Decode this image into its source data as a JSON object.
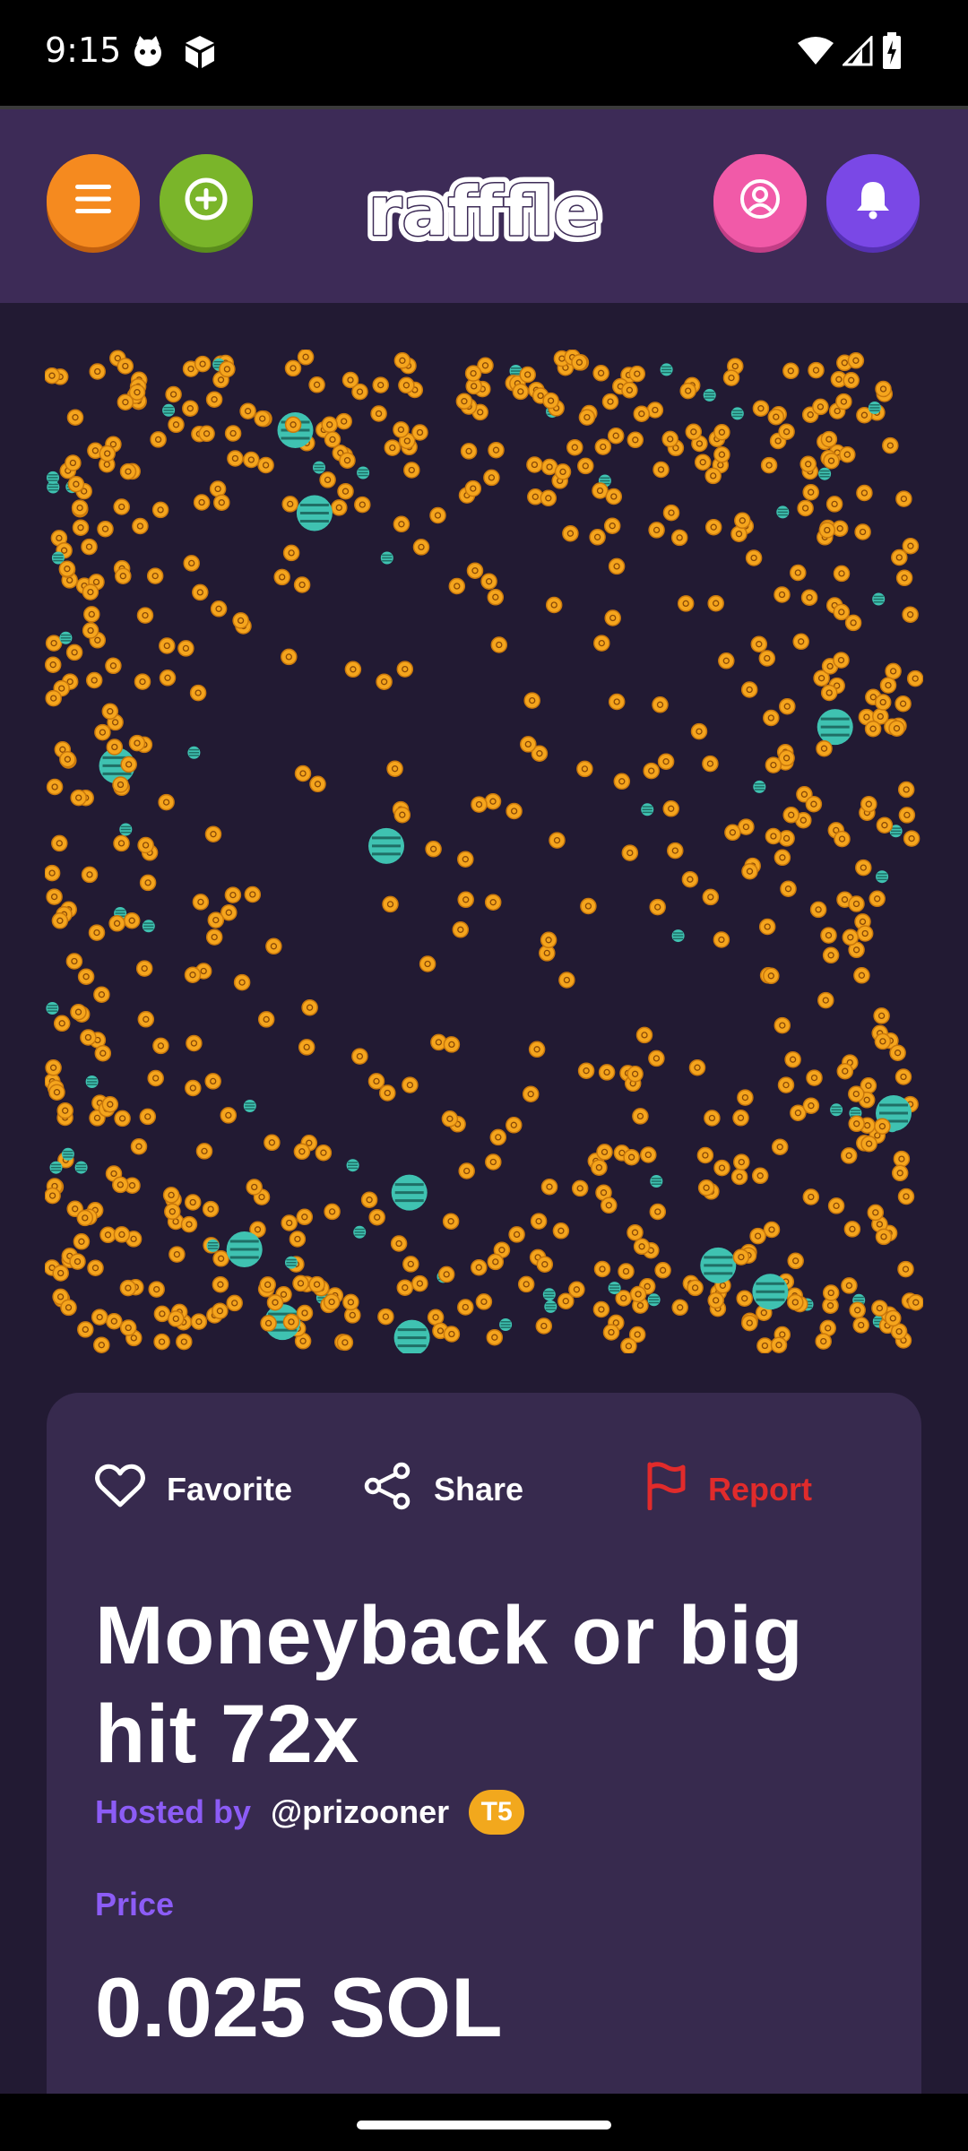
{
  "status_bar": {
    "time": "9:15",
    "left_icons": [
      "cat-face-icon",
      "cube-icon"
    ],
    "right_icons": [
      "wifi-icon",
      "cell-signal-icon",
      "battery-charging-icon"
    ]
  },
  "header": {
    "logo_text": "rafffle",
    "buttons": [
      "menu-icon",
      "plus-circle-icon",
      "user-icon",
      "bell-icon"
    ],
    "colors": {
      "header_bg": "#3d2b57",
      "menu": "#f58a1f",
      "add": "#7ab52a",
      "profile": "#f15aa8",
      "bell": "#7a48e6"
    }
  },
  "game": {
    "token_colors": {
      "coin": "#f5a51d",
      "orb": "#3fc2b1"
    }
  },
  "card": {
    "actions": {
      "favorite": "Favorite",
      "share": "Share",
      "report": "Report"
    },
    "title": "Moneyback or big hit 72x",
    "hosted_by_label": "Hosted by",
    "host": "@prizooner",
    "tier": "T5",
    "price_label": "Price",
    "price": "0.025 SOL",
    "colors": {
      "accent": "#8c5cf6",
      "report": "#e12b2b",
      "badge": "#f2a81d"
    }
  }
}
